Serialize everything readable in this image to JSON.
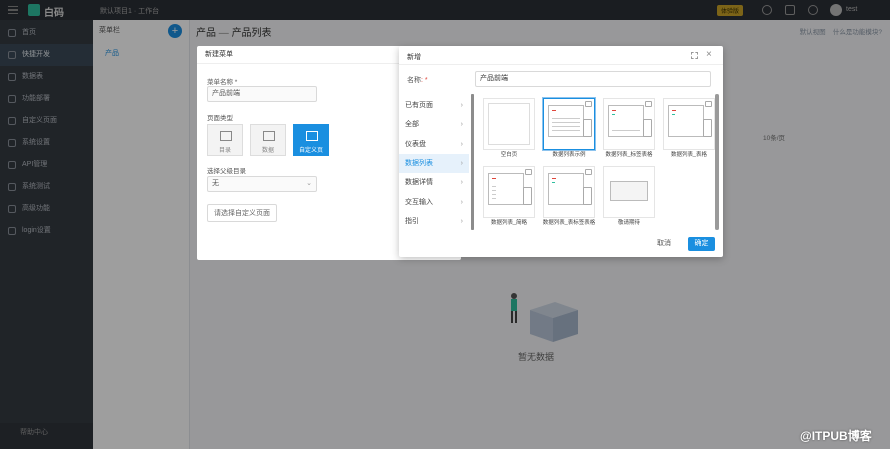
{
  "topbar": {
    "brand": "白码",
    "workspace": "默认项目1 · 工作台",
    "version_badge": "体验版",
    "user": "test"
  },
  "sidebar": {
    "items": [
      {
        "label": "首页",
        "active": false
      },
      {
        "label": "快捷开发",
        "active": true
      },
      {
        "label": "数据表",
        "active": false
      },
      {
        "label": "功能部署",
        "active": false
      },
      {
        "label": "自定义页面",
        "active": false
      },
      {
        "label": "系统设置",
        "active": false
      },
      {
        "label": "API管理",
        "active": false
      },
      {
        "label": "系统测试",
        "active": false
      },
      {
        "label": "高级功能",
        "active": false
      },
      {
        "label": "login设置",
        "active": false
      }
    ],
    "footer": "帮助中心"
  },
  "tree": {
    "head": "菜单栏",
    "plus": "+",
    "node": "产品"
  },
  "main": {
    "breadcrumb": {
      "a": "产品",
      "sep": "—",
      "b": "产品列表"
    },
    "right_tool_1": "默认视图",
    "right_tool_2": "什么是功能模块?",
    "pager": "10条/页",
    "empty_text": "暂无数据"
  },
  "back_dialog": {
    "title": "新建菜单",
    "name_label": "菜单名称 *",
    "name_value": "产品前端",
    "type_label": "页面类型",
    "types": [
      {
        "label": "目录",
        "active": false
      },
      {
        "label": "数据",
        "active": false
      },
      {
        "label": "自定义页",
        "active": true
      }
    ],
    "parent_label": "选择父级目录",
    "parent_value": "无",
    "choose_button": "请选择自定义页面"
  },
  "dialog": {
    "title": "新增",
    "name_label": "名称",
    "name_required": ": *",
    "name_value": "产品前端",
    "categories": [
      "已有页面",
      "全部",
      "仪表盘",
      "数据列表",
      "数据详情",
      "交互输入",
      "指引"
    ],
    "active_category": 3,
    "cards": [
      {
        "label": "空白页",
        "kind": "blank"
      },
      {
        "label": "数据列表示例",
        "kind": "list",
        "selected": true
      },
      {
        "label": "数据列表_标签表格",
        "kind": "list"
      },
      {
        "label": "数据列表_表格",
        "kind": "list"
      },
      {
        "label": "数据列表_简略",
        "kind": "list"
      },
      {
        "label": "数据列表_表标签表格",
        "kind": "list"
      },
      {
        "label": "敬请期待",
        "kind": "wait"
      }
    ],
    "cancel": "取消",
    "ok": "确定"
  },
  "watermark": "@ITPUB博客",
  "colors": {
    "accent": "#1a8fe0",
    "sidebar_bg": "#343a42",
    "topbar_bg": "#2b2f36"
  }
}
